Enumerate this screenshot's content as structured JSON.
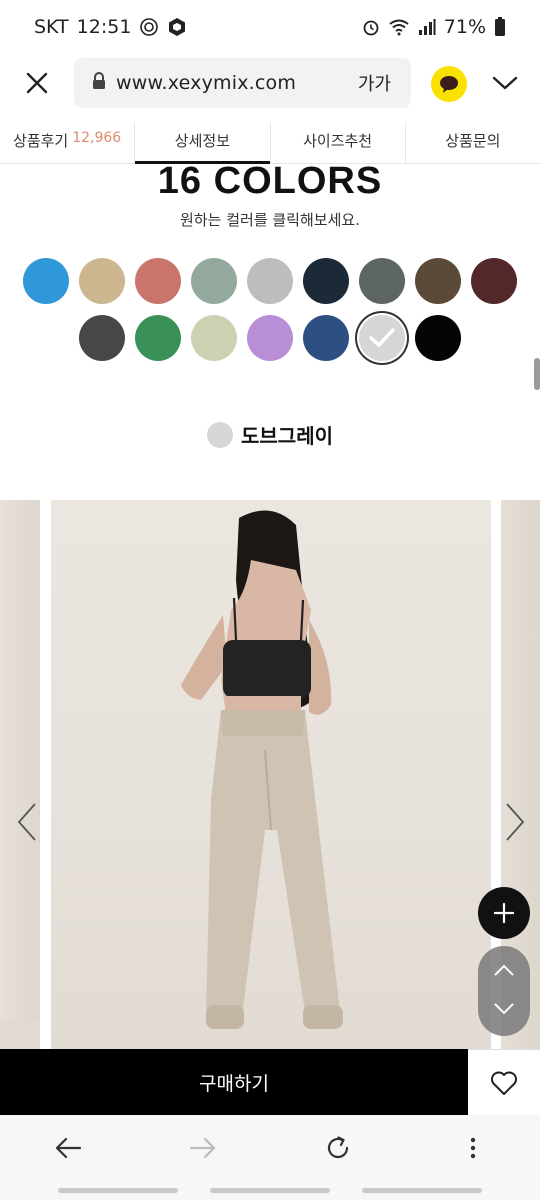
{
  "status_bar": {
    "carrier": "SKT",
    "time": "12:51",
    "battery": "71%"
  },
  "browser": {
    "url": "www.xexymix.com",
    "text_size_label": "가가"
  },
  "tabs": [
    {
      "label": "상품후기",
      "count": "12,966"
    },
    {
      "label": "상세정보",
      "count": ""
    },
    {
      "label": "사이즈추천",
      "count": ""
    },
    {
      "label": "상품문의",
      "count": ""
    }
  ],
  "colors_section": {
    "title": "16 COLORS",
    "subtitle": "원하는 컬러를 클릭해보세요.",
    "row1": [
      "#2f98d9",
      "#cbb68f",
      "#c9756c",
      "#94a99d",
      "#bdbdbd",
      "#1b2a36",
      "#5d6660",
      "#5c4a38",
      "#53282b"
    ],
    "row2": [
      "#474747",
      "#3a9158",
      "#cdd1b1",
      "#b88fd6",
      "#2e4f82",
      "#d6d6d6",
      "#050505"
    ],
    "selected_index": 5,
    "selected_name": "도브그레이",
    "selected_color": "#d6d6d6"
  },
  "buy": {
    "label": "구매하기"
  }
}
